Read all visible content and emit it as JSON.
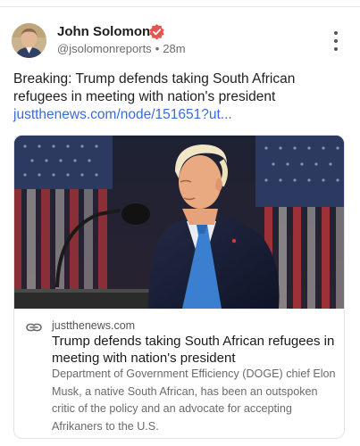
{
  "post": {
    "author": {
      "name": "John Solomon",
      "handle": "@jsolomonreports",
      "time": "28m",
      "separator": "•"
    },
    "text": "Breaking: Trump defends taking South African refugees in meeting with nation's president",
    "link_text": "justthenews.com/node/151651?ut..."
  },
  "card": {
    "domain": "justthenews.com",
    "title": "Trump defends taking South African refugees in meeting with nation's president",
    "description": "Department of Government Efficiency (DOGE) chief Elon Musk, a native South African, has been an outspoken critic of the policy and an advocate for accepting Afrikaners to the U.S."
  },
  "colors": {
    "badge": "#e8534f",
    "link": "#3b6bd6",
    "meta": "#6b6b6b"
  },
  "icons": {
    "verified": "verified-badge-icon",
    "more": "more-vertical-icon",
    "link": "link-icon"
  }
}
